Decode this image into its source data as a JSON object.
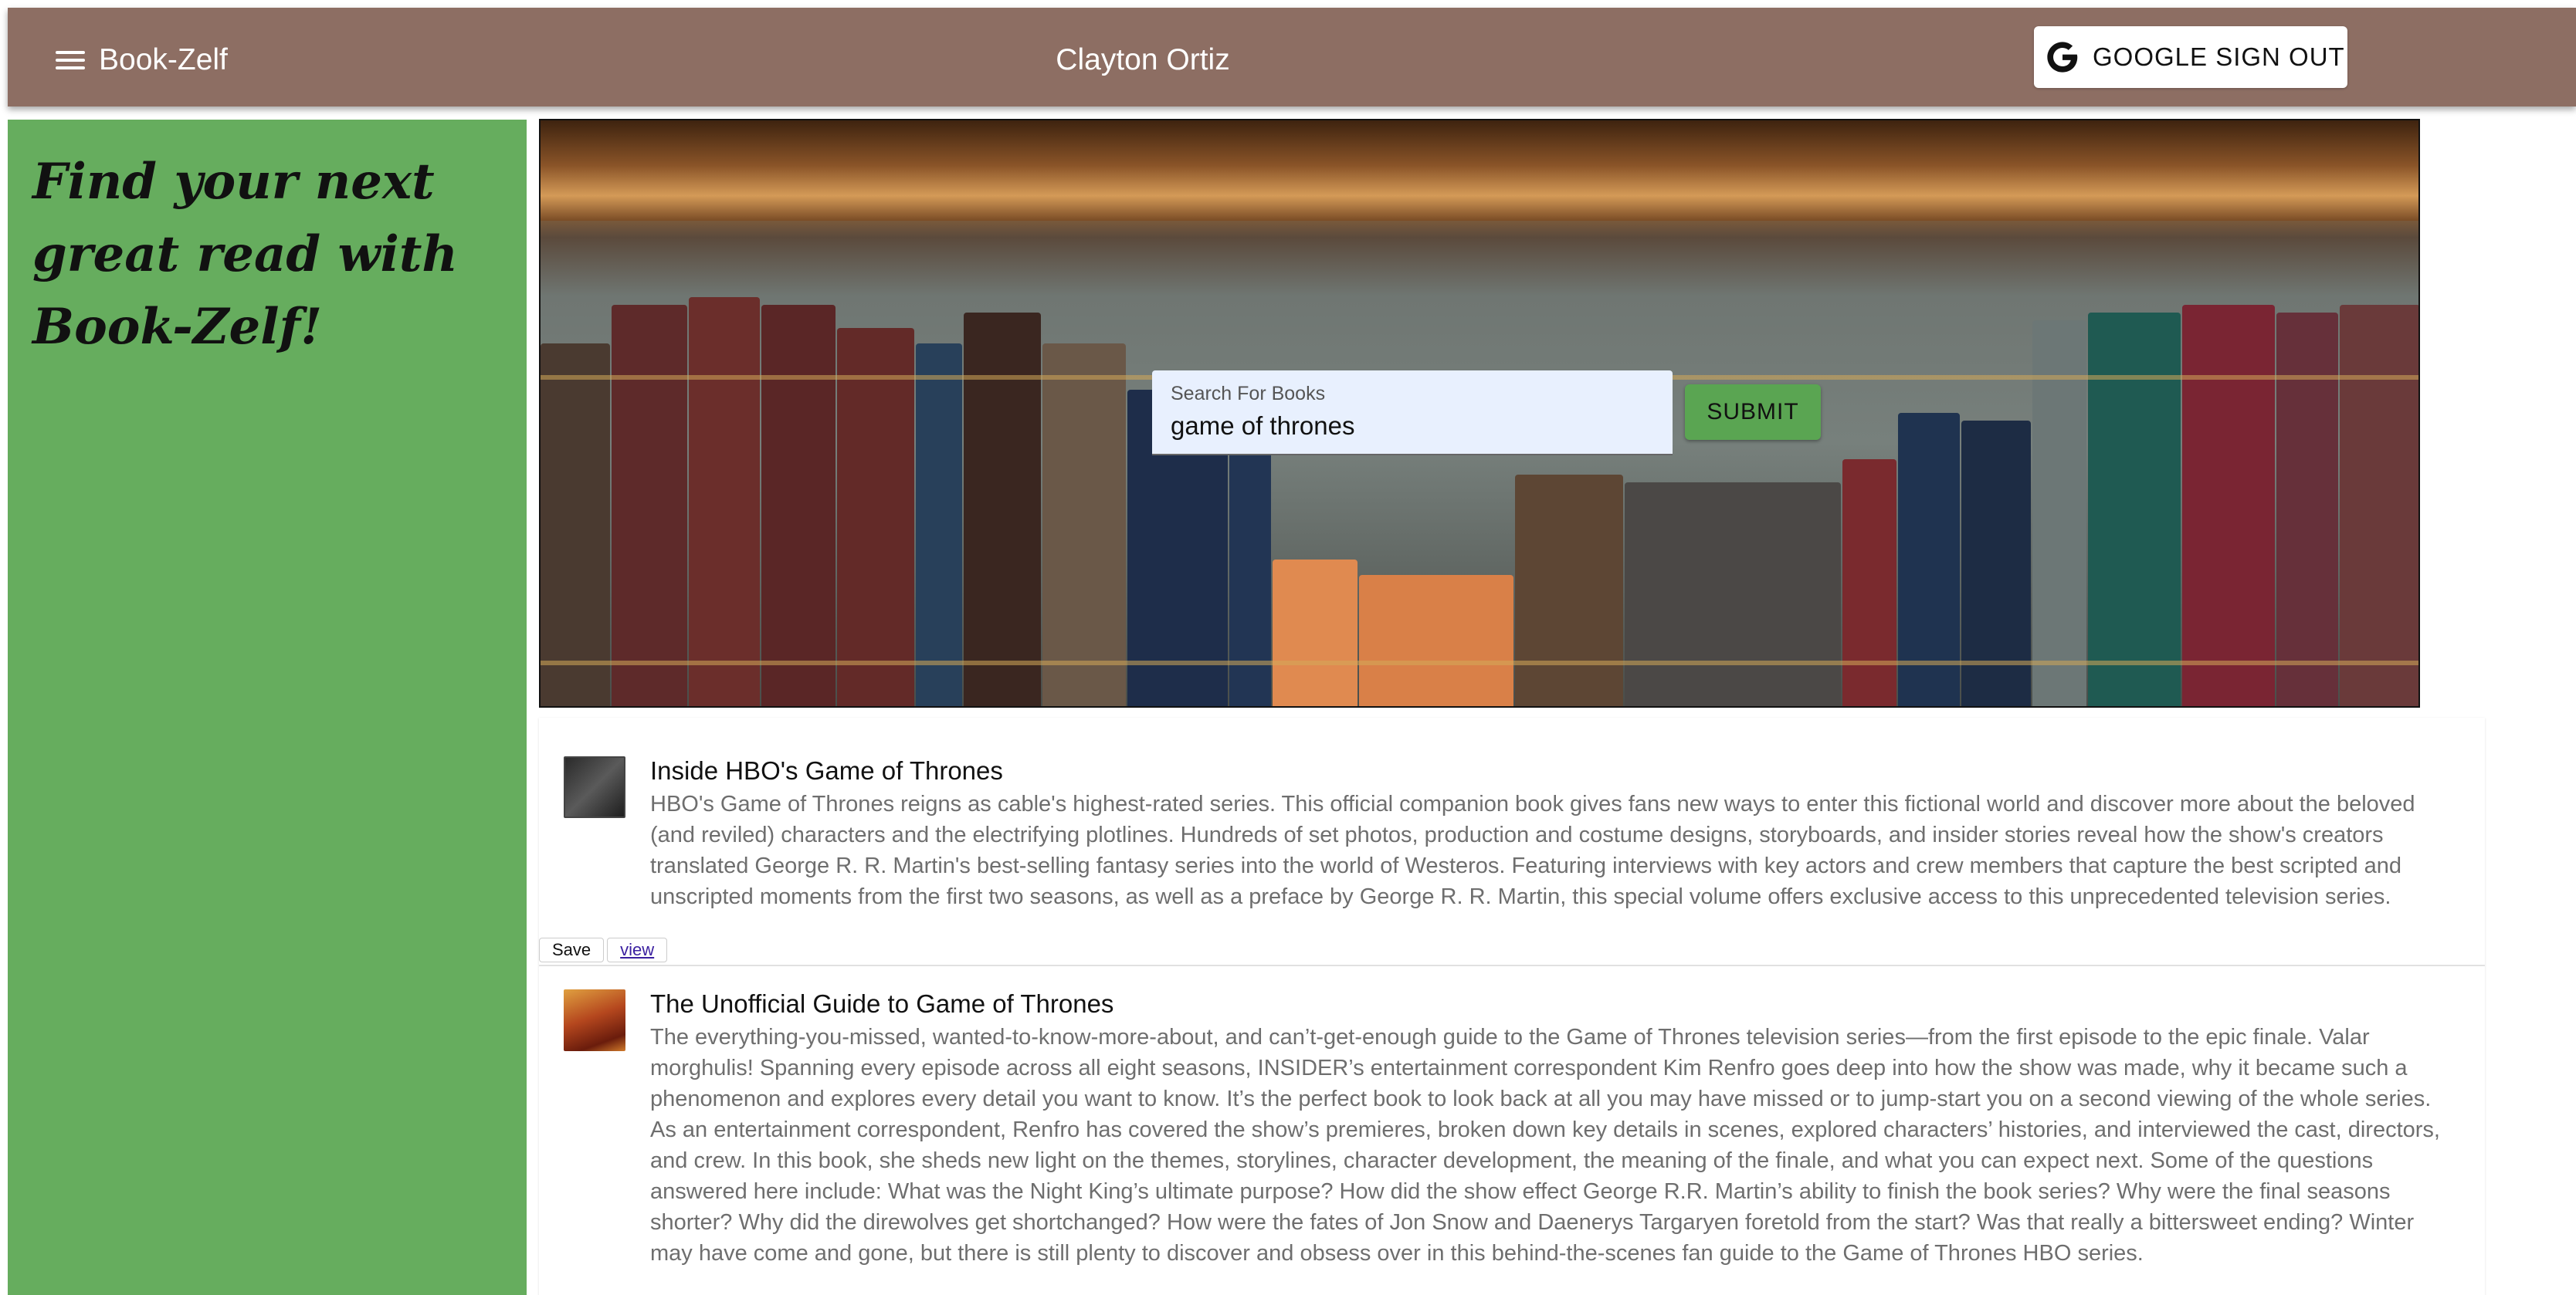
{
  "header": {
    "brand": "Book-Zelf",
    "user_name": "Clayton Ortiz",
    "signout_label": "GOOGLE SIGN OUT",
    "color": "#8d6e63"
  },
  "sidebar": {
    "tagline": "Find your next great read with Book-Zelf!",
    "color": "#66ad5e"
  },
  "search": {
    "label": "Search For Books",
    "value": "game of thrones",
    "submit_label": "SUBMIT"
  },
  "results": [
    {
      "title": "Inside HBO's Game of Thrones",
      "description": "HBO's Game of Thrones reigns as cable's highest-rated series. This official companion book gives fans new ways to enter this fictional world and discover more about the beloved (and reviled) characters and the electrifying plotlines. Hundreds of set photos, production and costume designs, storyboards, and insider stories reveal how the show's creators translated George R. R. Martin's best-selling fantasy series into the world of Westeros. Featuring interviews with key actors and crew members that capture the best scripted and unscripted moments from the first two seasons, as well as a preface by George R. R. Martin, this special volume offers exclusive access to this unprecedented television series.",
      "save_label": "Save",
      "view_label": "view"
    },
    {
      "title": "The Unofficial Guide to Game of Thrones",
      "description": "The everything-you-missed, wanted-to-know-more-about, and can’t-get-enough guide to the Game of Thrones television series—from the first episode to the epic finale. Valar morghulis! Spanning every episode across all eight seasons, INSIDER’s entertainment correspondent Kim Renfro goes deep into how the show was made, why it became such a phenomenon and explores every detail you want to know. It’s the perfect book to look back at all you may have missed or to jump-start you on a second viewing of the whole series. As an entertainment correspondent, Renfro has covered the show’s premieres, broken down key details in scenes, explored characters’ histories, and interviewed the cast, directors, and crew. In this book, she sheds new light on the themes, storylines, character development, the meaning of the finale, and what you can expect next. Some of the questions answered here include: What was the Night King’s ultimate purpose? How did the show effect George R.R. Martin’s ability to finish the book series? Why were the final seasons shorter? Why did the direwolves get shortchanged? How were the fates of Jon Snow and Daenerys Targaryen foretold from the start? Was that really a bittersweet ending? Winter may have come and gone, but there is still plenty to discover and obsess over in this behind-the-scenes fan guide to the Game of Thrones HBO series."
    }
  ]
}
